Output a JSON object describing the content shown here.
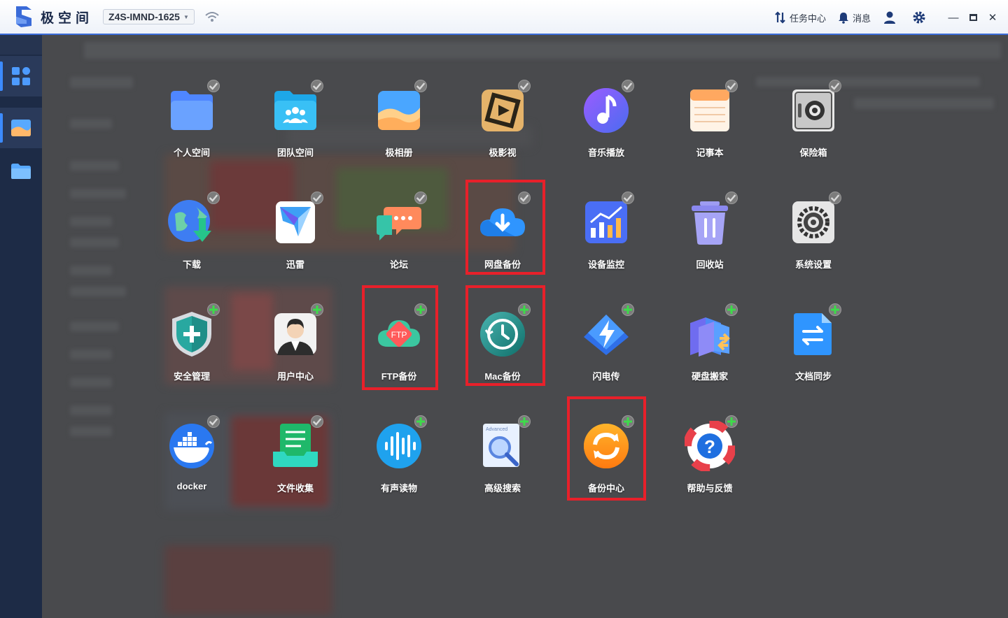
{
  "titlebar": {
    "app_name": "极空间",
    "device_name": "Z4S-IMND-1625",
    "task_center": "任务中心",
    "messages": "消息"
  },
  "sidebar": {
    "items": [
      {
        "icon": "apps-grid-icon",
        "selected": true
      },
      {
        "icon": "photo-album-icon",
        "selected": false
      },
      {
        "icon": "folder-icon",
        "selected": false
      }
    ]
  },
  "apps": [
    {
      "label": "个人空间",
      "icon": "personal-space-icon",
      "badge": "installed"
    },
    {
      "label": "团队空间",
      "icon": "team-space-icon",
      "badge": "installed"
    },
    {
      "label": "极相册",
      "icon": "photo-album-icon",
      "badge": "installed"
    },
    {
      "label": "极影视",
      "icon": "video-icon",
      "badge": "installed"
    },
    {
      "label": "音乐播放",
      "icon": "music-icon",
      "badge": "installed"
    },
    {
      "label": "记事本",
      "icon": "notepad-icon",
      "badge": "installed"
    },
    {
      "label": "保险箱",
      "icon": "safe-icon",
      "badge": "installed"
    },
    {
      "label": "下载",
      "icon": "download-icon",
      "badge": "installed"
    },
    {
      "label": "迅雷",
      "icon": "xunlei-icon",
      "badge": "installed"
    },
    {
      "label": "论坛",
      "icon": "forum-icon",
      "badge": "installed"
    },
    {
      "label": "网盘备份",
      "icon": "cloud-backup-icon",
      "badge": "installed"
    },
    {
      "label": "设备监控",
      "icon": "device-monitor-icon",
      "badge": "installed"
    },
    {
      "label": "回收站",
      "icon": "recycle-bin-icon",
      "badge": "installed"
    },
    {
      "label": "系统设置",
      "icon": "settings-icon",
      "badge": "installed"
    },
    {
      "label": "安全管理",
      "icon": "security-shield-icon",
      "badge": "add"
    },
    {
      "label": "用户中心",
      "icon": "user-center-icon",
      "badge": "add"
    },
    {
      "label": "FTP备份",
      "icon": "ftp-backup-icon",
      "badge": "add"
    },
    {
      "label": "Mac备份",
      "icon": "mac-backup-icon",
      "badge": "add"
    },
    {
      "label": "闪电传",
      "icon": "lightning-transfer-icon",
      "badge": "add"
    },
    {
      "label": "硬盘搬家",
      "icon": "disk-migration-icon",
      "badge": "add"
    },
    {
      "label": "文档同步",
      "icon": "doc-sync-icon",
      "badge": "add"
    },
    {
      "label": "docker",
      "icon": "docker-icon",
      "badge": "installed"
    },
    {
      "label": "文件收集",
      "icon": "file-collect-icon",
      "badge": "installed"
    },
    {
      "label": "有声读物",
      "icon": "audiobook-icon",
      "badge": "add"
    },
    {
      "label": "高级搜索",
      "icon": "advanced-search-icon",
      "badge": "add"
    },
    {
      "label": "备份中心",
      "icon": "backup-center-icon",
      "badge": "add"
    },
    {
      "label": "帮助与反馈",
      "icon": "help-feedback-icon",
      "badge": "add"
    }
  ],
  "advanced_search_tag": "Advanced",
  "ftp_tag": "FTP",
  "colors": {
    "accent": "#3c8bff",
    "highlight": "#e8202a",
    "sidebar": "#1d2b46"
  }
}
